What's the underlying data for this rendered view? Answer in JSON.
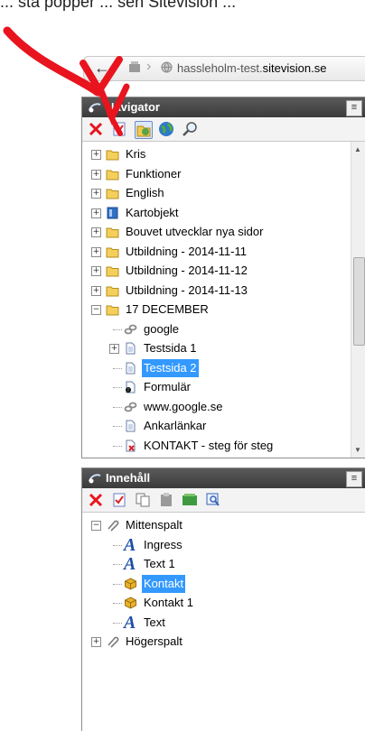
{
  "caption": "... sta popper ... sen Sitevision ... ",
  "browser": {
    "back": "←",
    "url_prefix": "hassleholm-test.",
    "url_domain": "sitevision.se"
  },
  "navigator": {
    "title": "Navigator",
    "menu": "≡",
    "items": [
      {
        "label": "Kris",
        "icon": "folder-icon",
        "expander": "+"
      },
      {
        "label": "Funktioner",
        "icon": "folder-icon",
        "expander": "+"
      },
      {
        "label": "English",
        "icon": "folder-icon",
        "expander": "+"
      },
      {
        "label": "Kartobjekt",
        "icon": "book-icon",
        "expander": "+"
      },
      {
        "label": "Bouvet utvecklar nya sidor",
        "icon": "folder-icon",
        "expander": "+"
      },
      {
        "label": "Utbildning - 2014-11-11",
        "icon": "folder-icon",
        "expander": "+"
      },
      {
        "label": "Utbildning - 2014-11-12",
        "icon": "folder-icon",
        "expander": "+"
      },
      {
        "label": "Utbildning - 2014-11-13",
        "icon": "folder-icon",
        "expander": "+"
      },
      {
        "label": "17 DECEMBER",
        "icon": "folder-icon",
        "expander": "−"
      },
      {
        "label": "google",
        "icon": "link-icon"
      },
      {
        "label": "Testsida 1",
        "icon": "page-icon",
        "expander": "+"
      },
      {
        "label": "Testsida 2",
        "icon": "page-icon",
        "selected": true
      },
      {
        "label": "Formulär",
        "icon": "form-page-icon"
      },
      {
        "label": "www.google.se",
        "icon": "link-icon"
      },
      {
        "label": "Ankarlänkar",
        "icon": "page-icon"
      },
      {
        "label": "KONTAKT - steg för steg",
        "icon": "page-red-icon"
      }
    ]
  },
  "content": {
    "title": "Innehåll",
    "menu": "≡",
    "items": [
      {
        "label": "Mittenspalt",
        "icon": "paperclip-icon",
        "expander": "−"
      },
      {
        "label": "Ingress",
        "icon": "text-a-icon",
        "glyph": "A"
      },
      {
        "label": "Text 1",
        "icon": "text-a-icon",
        "glyph": "A"
      },
      {
        "label": "Kontakt",
        "icon": "cube-icon",
        "selected": true
      },
      {
        "label": "Kontakt 1",
        "icon": "cube-icon"
      },
      {
        "label": "Text",
        "icon": "text-a-icon",
        "glyph": "A"
      },
      {
        "label": "Högerspalt",
        "icon": "paperclip-icon",
        "expander": "+"
      }
    ]
  },
  "colors": {
    "arrow": "#e8141e",
    "header": "#444444",
    "selection": "#3399ff"
  }
}
